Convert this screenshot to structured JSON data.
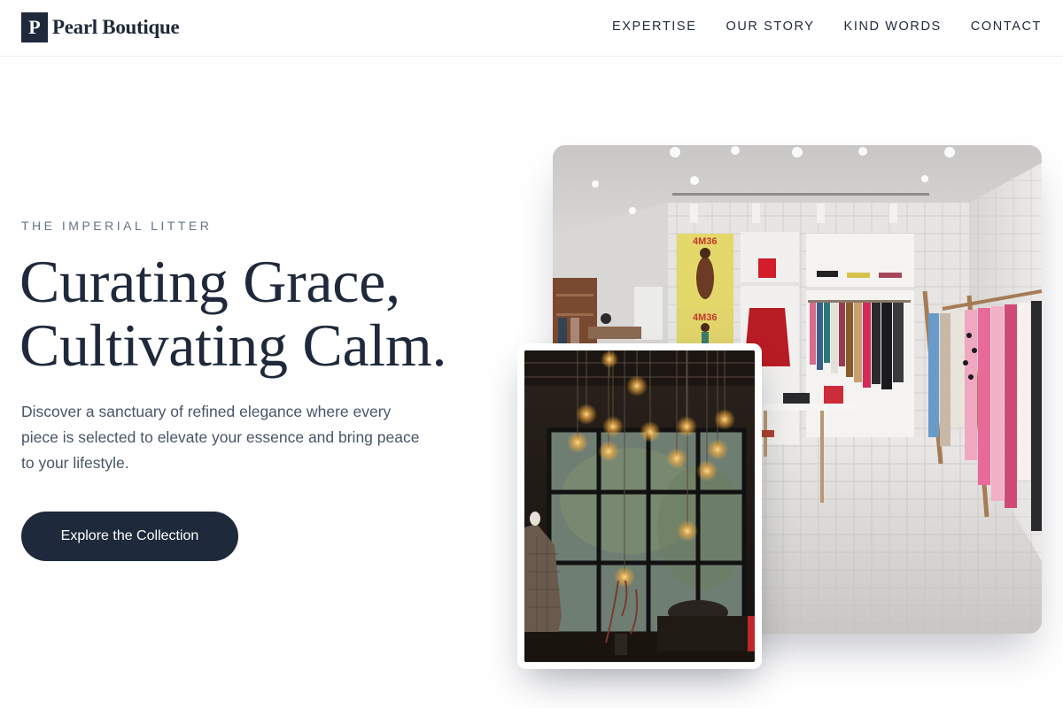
{
  "brand": {
    "mark": "P",
    "name": "Pearl Boutique"
  },
  "nav": [
    {
      "label": "EXPERTISE"
    },
    {
      "label": "OUR STORY"
    },
    {
      "label": "KIND WORDS"
    },
    {
      "label": "CONTACT"
    }
  ],
  "hero": {
    "eyebrow": "THE IMPERIAL LITTER",
    "headline_line1": "Curating Grace,",
    "headline_line2": "Cultivating Calm.",
    "description": "Discover a sanctuary of refined elegance where every piece is selected to elevate your essence and bring peace to your lifestyle.",
    "cta_label": "Explore the Collection"
  },
  "images": {
    "main": {
      "poster_text_1": "4M36",
      "poster_text_2": "4M36"
    }
  },
  "colors": {
    "primary": "#1e293b",
    "muted": "#64748b",
    "body_text": "#475569",
    "background": "#ffffff"
  }
}
